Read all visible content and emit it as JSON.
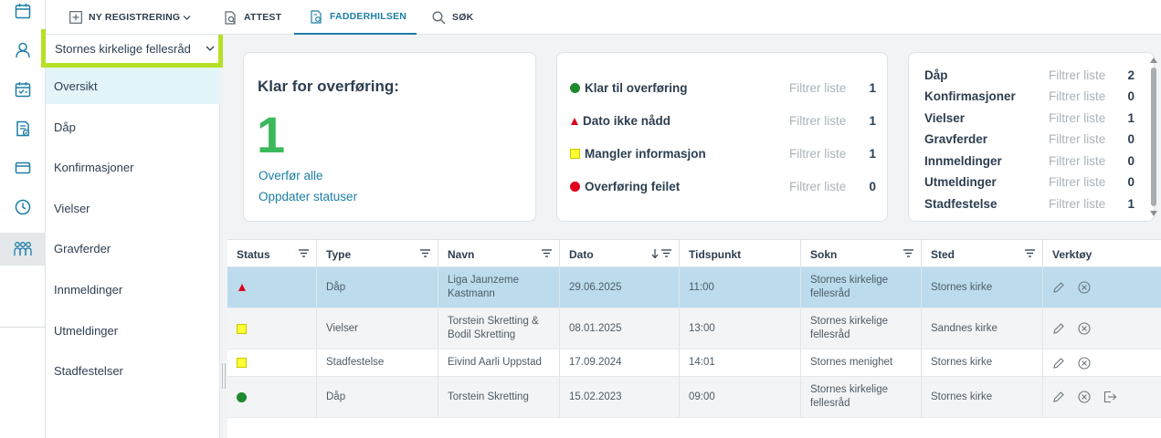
{
  "topbar": {
    "tabs": [
      {
        "label": "NY REGISTRERING",
        "icon": "plus-square-icon",
        "dropdown": true
      },
      {
        "label": "ATTEST",
        "icon": "document-search-icon"
      },
      {
        "label": "FADDERHILSEN",
        "icon": "document-gear-icon",
        "active": true
      },
      {
        "label": "SØK",
        "icon": "search-icon"
      }
    ]
  },
  "icon_rail": [
    "calendar-icon",
    "person-icon",
    "calendar-check-icon",
    "document-check-icon",
    "card-icon",
    "clock-icon",
    "people-icon"
  ],
  "sidebar": {
    "org_selector": "Stornes kirkelige fellesråd",
    "items": [
      "Oversikt",
      "Dåp",
      "Konfirmasjoner",
      "Vielser",
      "Gravferder",
      "Innmeldinger",
      "Utmeldinger",
      "Stadfestelser"
    ],
    "active": "Oversikt"
  },
  "ready_card": {
    "title": "Klar for overføring:",
    "count": "1",
    "link_transfer_all": "Overfør alle",
    "link_update_status": "Oppdater statuser"
  },
  "status_card": {
    "rows": [
      {
        "label": "Klar til overføring",
        "marker": "green-dot",
        "filter": "Filtrer liste",
        "count": "1"
      },
      {
        "label": "Dato ikke nådd",
        "marker": "red-triangle",
        "filter": "Filtrer liste",
        "count": "1"
      },
      {
        "label": "Mangler informasjon",
        "marker": "yellow-square",
        "filter": "Filtrer liste",
        "count": "1"
      },
      {
        "label": "Overføring feilet",
        "marker": "red-dot",
        "filter": "Filtrer liste",
        "count": "0"
      }
    ]
  },
  "type_card": {
    "rows": [
      {
        "label": "Dåp",
        "filter": "Filtrer liste",
        "count": "2"
      },
      {
        "label": "Konfirmasjoner",
        "filter": "Filtrer liste",
        "count": "0"
      },
      {
        "label": "Vielser",
        "filter": "Filtrer liste",
        "count": "1"
      },
      {
        "label": "Gravferder",
        "filter": "Filtrer liste",
        "count": "0"
      },
      {
        "label": "Innmeldinger",
        "filter": "Filtrer liste",
        "count": "0"
      },
      {
        "label": "Utmeldinger",
        "filter": "Filtrer liste",
        "count": "0"
      },
      {
        "label": "Stadfestelse",
        "filter": "Filtrer liste",
        "count": "1"
      }
    ]
  },
  "table": {
    "columns": [
      "Status",
      "Type",
      "Navn",
      "Dato",
      "Tidspunkt",
      "Sokn",
      "Sted",
      "Verktøy"
    ],
    "rows": [
      {
        "status": "red-triangle",
        "type": "Dåp",
        "navn": "Liga Jaunzeme Kastmann",
        "dato": "29.06.2025",
        "tid": "11:00",
        "sokn": "Stornes kirkelige fellesråd",
        "sted": "Stornes kirke"
      },
      {
        "status": "yellow-square",
        "type": "Vielser",
        "navn": "Torstein Skretting & Bodil Skretting",
        "dato": "08.01.2025",
        "tid": "13:00",
        "sokn": "Stornes kirkelige fellesråd",
        "sted": "Sandnes kirke"
      },
      {
        "status": "yellow-square",
        "type": "Stadfestelse",
        "navn": "Eivind Aarli Uppstad",
        "dato": "17.09.2024",
        "tid": "14:01",
        "sokn": "Stornes menighet",
        "sted": "Stornes kirke"
      },
      {
        "status": "green-dot",
        "type": "Dåp",
        "navn": "Torstein Skretting",
        "dato": "15.02.2023",
        "tid": "09:00",
        "sokn": "Stornes kirkelige fellesråd",
        "sted": "Stornes kirke"
      }
    ]
  },
  "colors": {
    "accent": "#1b7fa6",
    "green": "#1e8a2e",
    "big_number": "#3cb95a",
    "red": "#e0001b",
    "yellow": "#ffff33",
    "selected_row": "#bcdcee",
    "highlight_border": "#b5e026"
  }
}
